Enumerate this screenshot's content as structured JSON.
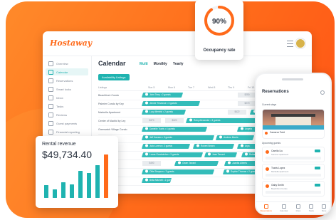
{
  "brand": "Hostaway",
  "sidebar": {
    "items": [
      {
        "label": "Overview",
        "active": false
      },
      {
        "label": "Calendar",
        "active": true
      },
      {
        "label": "Reservations",
        "active": false
      },
      {
        "label": "Smart locks",
        "active": false
      },
      {
        "label": "Inbox",
        "active": false
      },
      {
        "label": "Tasks",
        "active": false
      },
      {
        "label": "Reviews",
        "active": false
      },
      {
        "label": "Guest payments",
        "active": false
      },
      {
        "label": "Financial reporting",
        "active": false
      },
      {
        "label": "Owner statements",
        "active": false
      }
    ]
  },
  "calendar": {
    "title": "Calendar",
    "tabs": [
      "Multi",
      "Monthly",
      "Yearly"
    ],
    "active_tab": "Multi",
    "availability_button": "Availability Listings",
    "listing_header": "Listings",
    "days": [
      "Sun 5",
      "Mon 6",
      "Tue 7",
      "Wed 8",
      "Thu 9",
      "Fri 10"
    ],
    "rows": [
      {
        "listing": "Beachfront Condo",
        "bookings": [
          {
            "guest": "John Terry • 2 guests"
          },
          {
            "block": "$250"
          },
          {
            "block": "$250"
          }
        ]
      },
      {
        "listing": "Palmier Condo by Key",
        "bookings": [
          {
            "guest": "Jennie Trevanue • 3 guests"
          },
          {
            "block": "$270"
          },
          {
            "block": "$280"
          }
        ]
      },
      {
        "listing": "Marbella Apartment",
        "bookings": [
          {
            "guest": "Lucy Merield • 2 guests"
          },
          {
            "block": "$422"
          },
          {
            "guest": "Marie Anderson • 2 guests"
          }
        ]
      },
      {
        "listing": "Center of Madrid by Ley",
        "bookings": [
          {
            "block": "$370"
          },
          {
            "block": "$320"
          },
          {
            "guest": "Ruby Alexander • 3 guests"
          }
        ]
      },
      {
        "listing": "Greenwich Village Condo",
        "bookings": [
          {
            "guest": "Danielle Travis • 4 guests"
          },
          {
            "guest": "Angela"
          }
        ]
      },
      {
        "listing": "",
        "bookings": [
          {
            "guest": "Jeff Hansen • 3 guests"
          },
          {
            "guest": "Andrew Morris"
          },
          {
            "guest": "Jeff"
          }
        ]
      },
      {
        "listing": "",
        "bookings": [
          {
            "guest": "Julio Lorenz • 2 guests"
          },
          {
            "guest": "Robert Brown"
          },
          {
            "guest": "Arya"
          }
        ]
      },
      {
        "listing": "",
        "bookings": [
          {
            "guest": "Lucas Goodwinton • 3 guests"
          },
          {
            "guest": "Juan Tarrant"
          },
          {
            "guest": "Rubia Alberts"
          }
        ]
      },
      {
        "listing": "",
        "bookings": [
          {
            "block": "$490"
          },
          {
            "guest": "Owen Tarrant"
          },
          {
            "guest": "Juanita Alberts"
          }
        ]
      },
      {
        "listing": "",
        "bookings": [
          {
            "guest": "Ollie Simpson • 3 guests"
          },
          {
            "guest": "Sophie Thomas • 2 guests"
          }
        ]
      },
      {
        "listing": "",
        "bookings": [
          {
            "guest": "Bella Mitchell • 2 guests"
          }
        ]
      }
    ]
  },
  "occupancy": {
    "value": "90%",
    "percent": 90,
    "label": "Occupancy rate",
    "color": "#ff6a1a"
  },
  "revenue": {
    "label": "Rental revenue",
    "value": "$49,734.40",
    "bars": [
      0.28,
      0.18,
      0.35,
      0.3,
      0.6,
      0.55,
      0.72,
      0.95
    ],
    "highlight_index": 7
  },
  "phone": {
    "title": "Reservations",
    "current_stays": "Current stays",
    "property": "Cameron Todd",
    "upcoming": "Upcoming guests",
    "guests": [
      {
        "name": "Camila Liu",
        "sub": "Summer Apartment"
      },
      {
        "name": "Travis Lopez",
        "sub": "Marbella Apartment"
      },
      {
        "name": "Gaby Smith",
        "sub": "Beachfront Condo"
      }
    ],
    "tabs": [
      "Reservations",
      "Calendar",
      "Inbox",
      "Tasks",
      "More"
    ]
  },
  "colors": {
    "accent": "#ff6a1a",
    "teal": "#1fb3b0"
  }
}
